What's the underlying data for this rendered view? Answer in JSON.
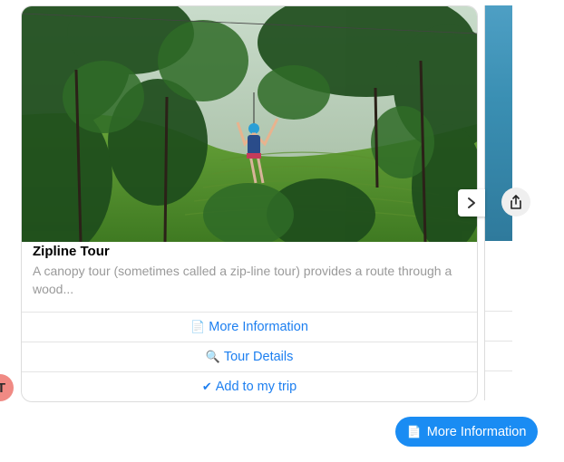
{
  "user": {
    "avatar_initial": "T"
  },
  "card": {
    "title": "Zipline Tour",
    "description": "A canopy tour (sometimes called a zip-line tour) provides a route through a wood...",
    "image_alt": "Person on zipline over tea plantation forest",
    "buttons": [
      {
        "icon": "📄",
        "label": "More Information"
      },
      {
        "icon": "🔍",
        "label": "Tour Details"
      },
      {
        "icon": "✔",
        "label": "Add to my trip"
      }
    ]
  },
  "carousel": {
    "next_icon": "chevron-right-icon"
  },
  "share": {
    "icon": "share-icon"
  },
  "reply": {
    "icon": "📄",
    "label": "More Information"
  },
  "colors": {
    "accent": "#1a8cf3",
    "link": "#1d7ff0",
    "avatar": "#f08a84"
  }
}
